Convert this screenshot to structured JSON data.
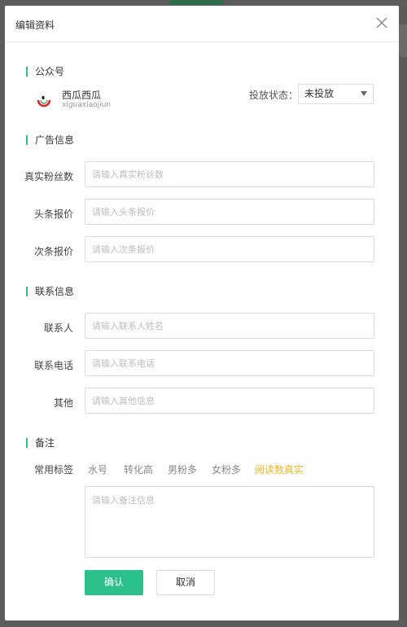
{
  "dialog": {
    "title": "编辑资料",
    "close_icon": "close-icon"
  },
  "account_section": {
    "title": "公众号",
    "name": "西瓜西瓜",
    "id": "xiguaxiaojiun",
    "status_label": "投放状态：",
    "status_value": "未投放"
  },
  "ad_section": {
    "title": "广告信息",
    "fields": [
      {
        "label": "真实粉丝数",
        "placeholder": "请输入真实粉丝数"
      },
      {
        "label": "头条报价",
        "placeholder": "请输入头条报价"
      },
      {
        "label": "次条报价",
        "placeholder": "请输入次条报价"
      }
    ]
  },
  "contact_section": {
    "title": "联系信息",
    "fields": [
      {
        "label": "联系人",
        "placeholder": "请输入联系人姓名"
      },
      {
        "label": "联系电话",
        "placeholder": "请输入联系电话"
      },
      {
        "label": "其他",
        "placeholder": "请输入其他信息"
      }
    ]
  },
  "notes_section": {
    "title": "备注",
    "tags_label": "常用标签",
    "tags": [
      "水号",
      "转化高",
      "男粉多",
      "女粉多",
      "阅读数真实"
    ],
    "active_tag": "阅读数真实",
    "textarea_placeholder": "请输入备注信息"
  },
  "actions": {
    "confirm": "确认",
    "cancel": "取消"
  },
  "colors": {
    "accent": "#2bbf8a",
    "active_tag": "#f0b429"
  }
}
